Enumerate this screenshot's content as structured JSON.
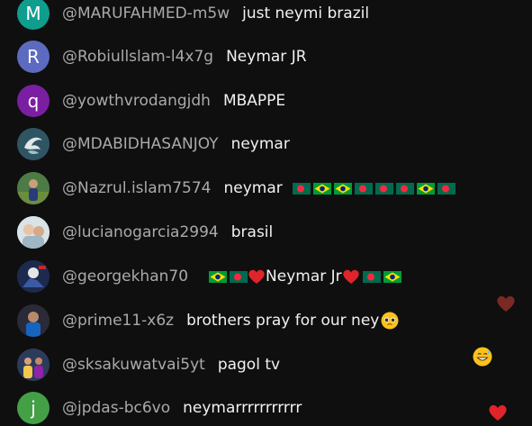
{
  "colors": {
    "background": "#0f0f0f",
    "author": "#aaaaaa",
    "message": "#f1f1f1",
    "heart_red": "#e0242b",
    "heart_dark": "#7a2a22"
  },
  "messages": [
    {
      "author": "@MARUFAHMED-m5w",
      "text": "just neymi brazil",
      "avatar_letter": "M",
      "avatar_color": "#0f9d8e"
    },
    {
      "author": "@Robiullslam-l4x7g",
      "text": "Neymar JR",
      "avatar_letter": "R",
      "avatar_color": "#5c6bc0"
    },
    {
      "author": "@yowthvrodangjdh",
      "text": "MBAPPE",
      "avatar_letter": "q",
      "avatar_color": "#7b1fa2"
    },
    {
      "author": "@MDABIDHASANJOY",
      "text": "neymar",
      "avatar_icon": "dragon-logo-icon"
    },
    {
      "author": "@Nazrul.islam7574",
      "text": "neymar",
      "avatar_icon": "photo-avatar-icon",
      "flags": [
        "bd",
        "br",
        "br",
        "bd",
        "bd",
        "bd",
        "br",
        "bd"
      ]
    },
    {
      "author": "@lucianogarcia2994",
      "text": "brasil",
      "avatar_icon": "photo-avatar-icon"
    },
    {
      "author": "@georgekhan70",
      "text_before": "",
      "text": "Neymar Jr",
      "avatar_icon": "photo-avatar-icon"
    },
    {
      "author": "@prime11-x6z",
      "text": "brothers pray for our ney",
      "avatar_icon": "photo-avatar-icon"
    },
    {
      "author": "@sksakuwatvai5yt",
      "text": "pagol tv",
      "avatar_icon": "photo-avatar-icon"
    },
    {
      "author": "@jpdas-bc6vo",
      "text": "neymarrrrrrrrrrr",
      "avatar_letter": "j",
      "avatar_color": "#43a047"
    }
  ]
}
